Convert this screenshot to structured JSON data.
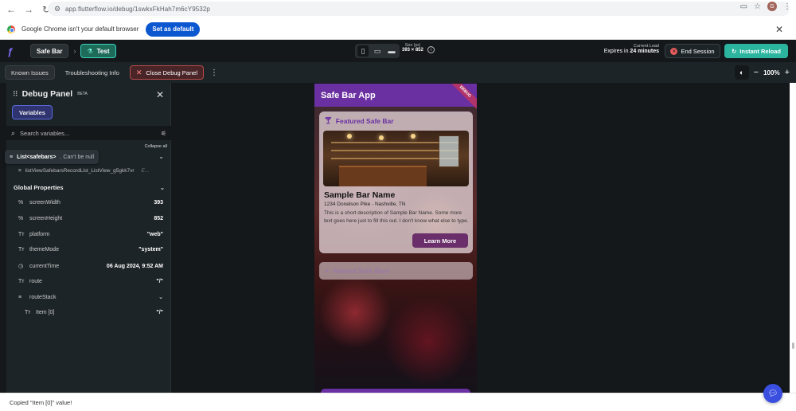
{
  "browser": {
    "url": "app.flutterflow.io/debug/1swkxFkHah7m6cY9532p",
    "infobar_message": "Google Chrome isn't your default browser",
    "set_default_label": "Set as default",
    "profile_initial": "G"
  },
  "toolbar": {
    "project_name": "Safe Bar",
    "mode_label": "Test",
    "size_label": "Size (px)",
    "size_value": "393 × 852",
    "current_load_label": "Current Load",
    "expires_prefix": "Expires in",
    "expires_value": "24 minutes",
    "end_session_label": "End Session",
    "instant_reload_label": "Instant Reload"
  },
  "secondary_toolbar": {
    "known_issues": "Known Issues",
    "troubleshooting": "Troubleshooting Info",
    "close_debug": "Close Debug Panel",
    "zoom": "100%"
  },
  "debug_panel": {
    "title": "Debug Panel",
    "badge": "BETA",
    "tab_variables": "Variables",
    "search_placeholder": "Search variables...",
    "collapse_all": "Collapse all",
    "tooltip_type": "List<safebars>",
    "tooltip_note": ". Can't be null",
    "list_var": "listViewSafebarsRecordList_ListView_g5gkk7vr",
    "list_ellipsis": "E...",
    "global_properties": "Global Properties",
    "props": [
      {
        "name": "screenWidth",
        "value": "393"
      },
      {
        "name": "screenHeight",
        "value": "852"
      },
      {
        "name": "platform",
        "value": "\"web\""
      },
      {
        "name": "themeMode",
        "value": "\"system\""
      },
      {
        "name": "currentTime",
        "value": "06 Aug 2024, 9:52 AM"
      },
      {
        "name": "route",
        "value": "\"/\""
      },
      {
        "name": "routeStack",
        "value": ""
      },
      {
        "name": "Item [0]",
        "value": "\"/\""
      }
    ]
  },
  "app": {
    "title": "Safe Bar App",
    "debug_ribbon": "DEBUG",
    "featured_label": "Featured Safe Bar",
    "bar_name": "Sample Bar Name",
    "bar_address": "1234 Donelson Pike - Nashville, TN",
    "bar_description": "This is a short description of Sample Bar Name. Some more text goes here just to fill this out. I don't know what else to type.",
    "learn_more": "Learn More",
    "newest_label": "Newest Safe Bars"
  },
  "status": {
    "message": "Copied \"Item [0]\" value!"
  },
  "colors": {
    "app_primary": "#6a2fa0",
    "instant_reload": "#2bb59f",
    "end_session": "#e85d5d"
  }
}
